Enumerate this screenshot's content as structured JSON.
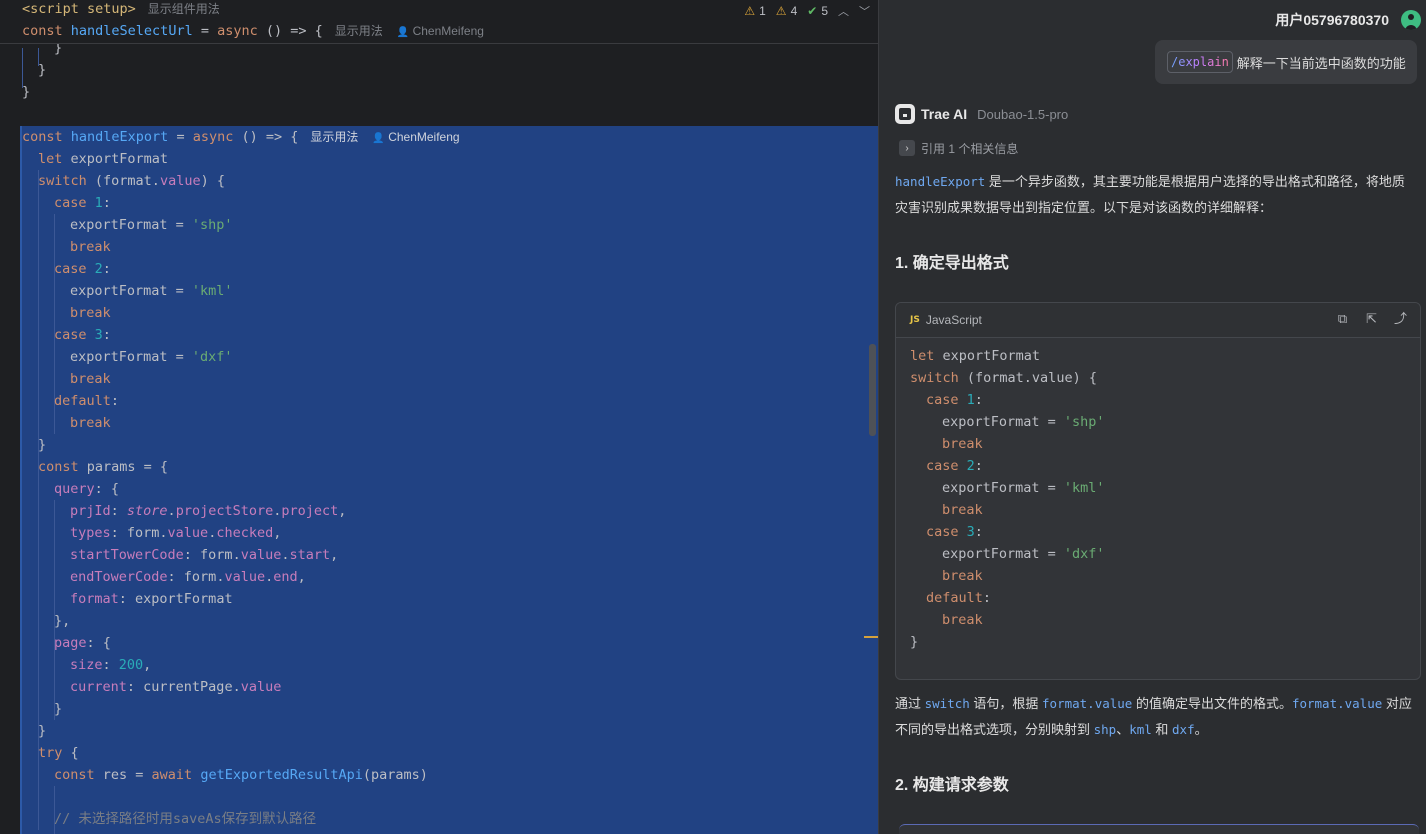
{
  "editor": {
    "sticky": {
      "line1": {
        "tag": "<script setup>",
        "hint": "显示组件用法"
      },
      "line2": {
        "pre": "const ",
        "fn": "handleSelectUrl",
        "mid": " = ",
        "kw": "async",
        "post": " () => {",
        "hint": "显示用法",
        "author": "ChenMeifeng"
      }
    },
    "inspection": {
      "warnings_a": "1",
      "warnings_b": "4",
      "ok": "5"
    },
    "lines": {
      "l1": "}",
      "l2": "}",
      "l3": "}",
      "export_decl": {
        "pre": "const ",
        "fn": "handleExport",
        "mid": " = ",
        "kw": "async",
        "post": " () => {",
        "hint": "显示用法",
        "author": "ChenMeifeng"
      },
      "let_line": {
        "kw": "let",
        "rest": " exportFormat"
      },
      "switch_line": {
        "kw": "switch",
        "a": " (format.",
        "prop": "value",
        "b": ") {"
      },
      "case1": {
        "kw": "case",
        "num": "1",
        "colon": ":"
      },
      "assign_shp": {
        "a": "exportFormat = ",
        "str": "'shp'"
      },
      "break": "break",
      "case2": {
        "kw": "case",
        "num": "2",
        "colon": ":"
      },
      "assign_kml": {
        "a": "exportFormat = ",
        "str": "'kml'"
      },
      "case3": {
        "kw": "case",
        "num": "3",
        "colon": ":"
      },
      "assign_dxf": {
        "a": "exportFormat = ",
        "str": "'dxf'"
      },
      "default": {
        "kw": "default",
        "colon": ":"
      },
      "close_brace": "}",
      "params_line": {
        "kw": "const",
        "rest": " params = {"
      },
      "query": {
        "prop": "query",
        "rest": ": {"
      },
      "prjId": {
        "prop": "prjId",
        "a": ": ",
        "it": "store",
        "b": ".",
        "p2": "projectStore",
        "c": ".",
        "p3": "project",
        "d": ","
      },
      "types": {
        "prop": "types",
        "a": ": form.",
        "p2": "value",
        "b": ".",
        "p3": "checked",
        "c": ","
      },
      "start": {
        "prop": "startTowerCode",
        "a": ": form.",
        "p2": "value",
        "b": ".",
        "p3": "start",
        "c": ","
      },
      "end": {
        "prop": "endTowerCode",
        "a": ": form.",
        "p2": "value",
        "b": ".",
        "p3": "end",
        "c": ","
      },
      "format": {
        "prop": "format",
        "a": ": exportFormat"
      },
      "close_comma": "},",
      "page": {
        "prop": "page",
        "rest": ": {"
      },
      "size": {
        "prop": "size",
        "a": ": ",
        "num": "200",
        "b": ","
      },
      "current": {
        "prop": "current",
        "a": ": currentPage.",
        "p2": "value"
      },
      "try_line": {
        "kw": "try",
        "rest": " {"
      },
      "res_line": {
        "kw": "const",
        "a": " res = ",
        "kw2": "await",
        "b": " ",
        "fn": "getExportedResultApi",
        "c": "(params)"
      },
      "comment": "// 未选择路径时用saveAs保存到默认路径"
    }
  },
  "chat": {
    "user_name": "用户05796780370",
    "user_message": {
      "command": "/explain",
      "text": "解释一下当前选中函数的功能"
    },
    "ai": {
      "name": "Trae AI",
      "model": "Doubao-1.5-pro",
      "reference": "引用 1 个相关信息"
    },
    "intro": {
      "code": "handleExport",
      "text": " 是一个异步函数，其主要功能是根据用户选择的导出格式和路径，将地质灾害识别成果数据导出到指定位置。以下是对该函数的详细解释："
    },
    "section1": "1. 确定导出格式",
    "code_block": {
      "language": "JavaScript",
      "badge": "JS",
      "lines": {
        "c1": {
          "kw": "let",
          "rest": " exportFormat"
        },
        "c2": {
          "kw": "switch",
          "rest": " (format.value) {"
        },
        "c3": {
          "kw": "case",
          "num": "1",
          "colon": ":"
        },
        "c4": {
          "a": "exportFormat = ",
          "str": "'shp'"
        },
        "c5": "break",
        "c6": {
          "kw": "case",
          "num": "2",
          "colon": ":"
        },
        "c7": {
          "a": "exportFormat = ",
          "str": "'kml'"
        },
        "c8": "break",
        "c9": {
          "kw": "case",
          "num": "3",
          "colon": ":"
        },
        "c10": {
          "a": "exportFormat = ",
          "str": "'dxf'"
        },
        "c11": "break",
        "c12": {
          "kw": "default",
          "colon": ":"
        },
        "c13": "break",
        "c14": "}"
      }
    },
    "explain1": {
      "t1": "通过 ",
      "c1": "switch",
      "t2": " 语句，根据 ",
      "c2": "format.value",
      "t3": " 的值确定导出文件的格式。",
      "c3": "format.value",
      "t4": " 对应不同的导出格式选项，分别映射到 ",
      "c4": "shp",
      "t5": "、",
      "c5": "kml",
      "t6": " 和 ",
      "c6": "dxf",
      "t7": "。"
    },
    "section2": "2. 构建请求参数"
  }
}
